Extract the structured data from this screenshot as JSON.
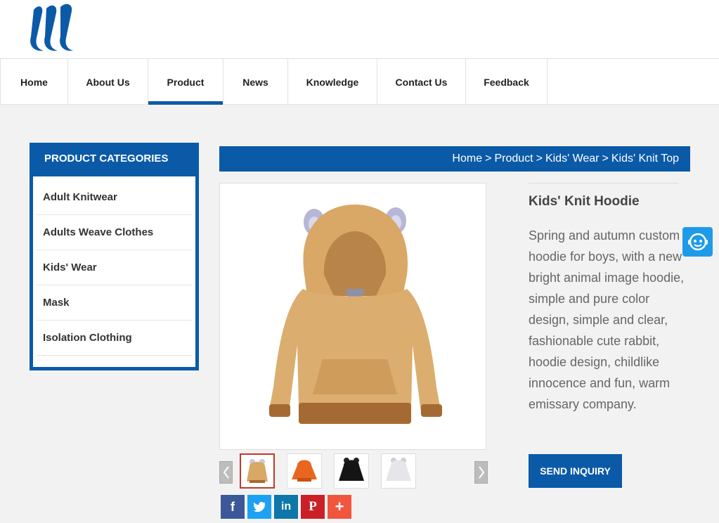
{
  "nav": {
    "items": [
      {
        "label": "Home"
      },
      {
        "label": "About Us"
      },
      {
        "label": "Product"
      },
      {
        "label": "News"
      },
      {
        "label": "Knowledge"
      },
      {
        "label": "Contact Us"
      },
      {
        "label": "Feedback"
      }
    ],
    "active_index": 2
  },
  "sidebar": {
    "title": "PRODUCT CATEGORIES",
    "items": [
      {
        "label": "Adult Knitwear"
      },
      {
        "label": "Adults Weave Clothes"
      },
      {
        "label": "Kids' Wear"
      },
      {
        "label": "Mask"
      },
      {
        "label": "Isolation Clothing"
      }
    ]
  },
  "breadcrumb": {
    "items": [
      "Home",
      "Product",
      "Kids' Wear",
      "Kids' Knit Top"
    ],
    "separator": ">"
  },
  "product": {
    "title": "Kids' Knit Hoodie",
    "description": "Spring and autumn custom hoodie for boys, with a new bright animal image hoodie, simple and pure color design, simple and clear, fashionable cute rabbit, hoodie design, childlike innocence and fun, warm emissary company.",
    "inquiry_label": "SEND INQUIRY",
    "thumbnails": [
      {
        "color": "tan",
        "selected": true
      },
      {
        "color": "orange",
        "selected": false
      },
      {
        "color": "black",
        "selected": false
      },
      {
        "color": "white",
        "selected": false
      }
    ]
  },
  "share": [
    {
      "icon": "facebook-icon",
      "color": "#3b5998"
    },
    {
      "icon": "twitter-icon",
      "color": "#1da1f2"
    },
    {
      "icon": "linkedin-icon",
      "color": "#0e76a8"
    },
    {
      "icon": "pinterest-icon",
      "color": "#cb2027"
    },
    {
      "icon": "plus-icon",
      "color": "#f2553d"
    }
  ],
  "colors": {
    "brand_blue": "#0b5aa8",
    "chat_blue": "#1e9be8",
    "thumb_selected_border": "#c0392b"
  }
}
